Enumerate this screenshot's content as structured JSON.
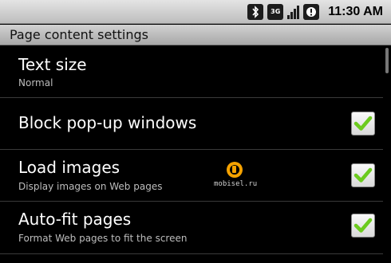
{
  "status_bar": {
    "network_type": "3G",
    "time": "11:30 AM",
    "icons": [
      "bluetooth-icon",
      "network-3g-icon",
      "signal-strength-icon",
      "battery-icon"
    ]
  },
  "title_bar": {
    "title": "Page content settings"
  },
  "settings": [
    {
      "title": "Text size",
      "summary": "Normal",
      "has_checkbox": false
    },
    {
      "title": "Block pop-up windows",
      "summary": "",
      "has_checkbox": true,
      "checked": true
    },
    {
      "title": "Load images",
      "summary": "Display images on Web pages",
      "has_checkbox": true,
      "checked": true
    },
    {
      "title": "Auto-fit pages",
      "summary": "Format Web pages to fit the screen",
      "has_checkbox": true,
      "checked": true
    }
  ],
  "watermark": {
    "text": "mobisel.ru"
  },
  "colors": {
    "check_green": "#6ccb1e",
    "list_background": "#000000",
    "title_text": "#ffffff",
    "summary_text": "#bdbdbd"
  }
}
